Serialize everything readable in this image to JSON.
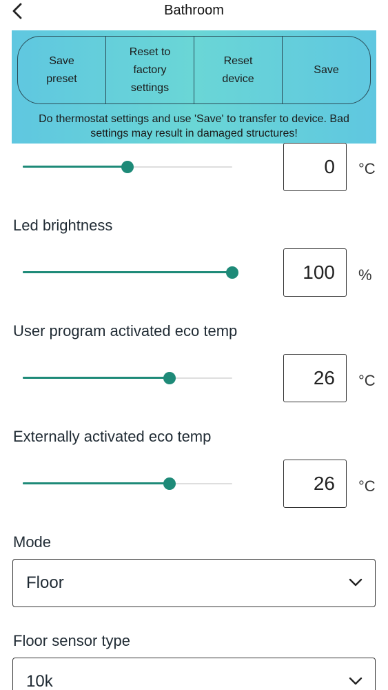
{
  "header": {
    "title": "Bathroom",
    "back_icon": "chevron-left-icon"
  },
  "actions": {
    "save_preset": "Save\npreset",
    "reset_factory": "Reset to\nfactory\nsettings",
    "reset_device": "Reset\ndevice",
    "save": "Save",
    "note": "Do thermostat settings and use 'Save' to transfer to device. Bad settings may result in damaged structures!"
  },
  "rows": {
    "first": {
      "value": "0",
      "unit": "°C",
      "slider_fraction": 0.5
    },
    "led_brightness": {
      "label": "Led brightness",
      "value": "100",
      "unit": "%",
      "slider_fraction": 1.0
    },
    "user_eco": {
      "label": "User program activated eco temp",
      "value": "26",
      "unit": "°C",
      "slider_fraction": 0.7
    },
    "external_eco": {
      "label": "Externally activated eco temp",
      "value": "26",
      "unit": "°C",
      "slider_fraction": 0.7
    }
  },
  "mode": {
    "label": "Mode",
    "value": "Floor"
  },
  "floor_sensor": {
    "label": "Floor sensor type",
    "value": "10k"
  },
  "colors": {
    "accent": "#1e8a78",
    "panel": "#5fc7e0",
    "track": "#dedede"
  }
}
